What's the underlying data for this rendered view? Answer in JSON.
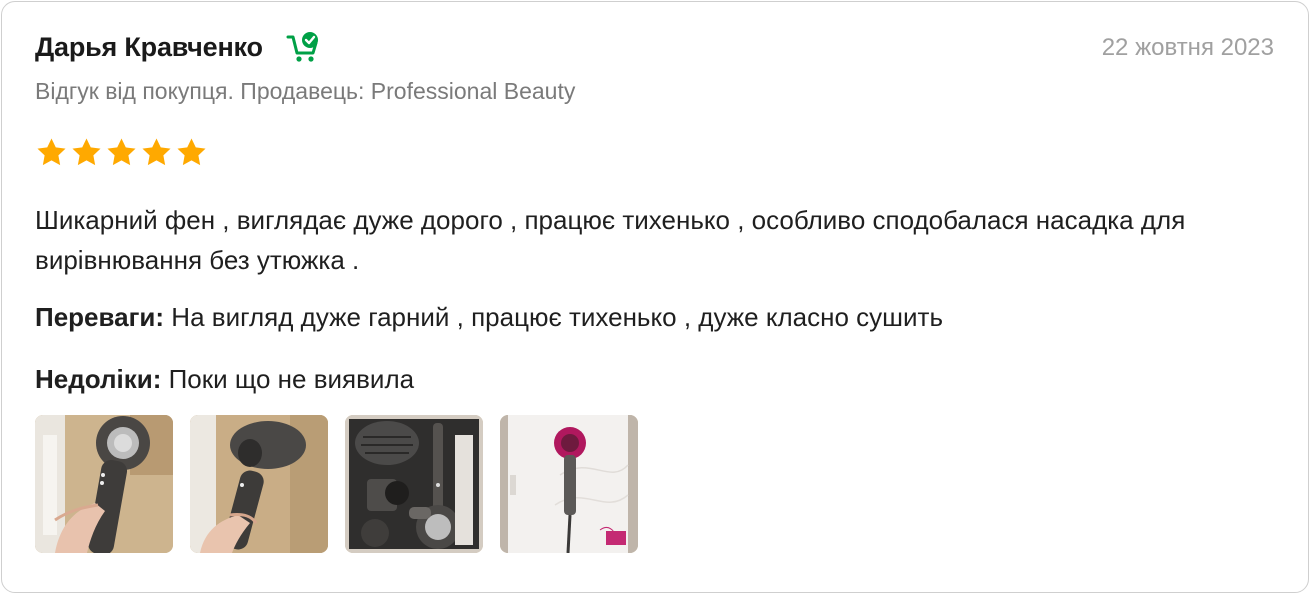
{
  "review": {
    "author": "Дарья Кравченко",
    "date": "22 жовтня 2023",
    "meta": "Відгук від покупця. Продавець: Professional Beauty",
    "rating": 5,
    "rating_max": 5,
    "text": "Шикарний фен , виглядає дуже дорого , працює тихенько , особливо сподобалася насадка для вирівнювання без утюжка .",
    "pros_label": "Переваги:",
    "pros_text": "На вигляд дуже гарний , працює тихенько , дуже класно сушить",
    "cons_label": "Недоліки:",
    "cons_text": "Поки що не виявила"
  },
  "colors": {
    "star": "#ffa900",
    "buyer_icon": "#00a046"
  },
  "icons": {
    "buyer": "cart-check-icon",
    "star": "star-icon"
  }
}
